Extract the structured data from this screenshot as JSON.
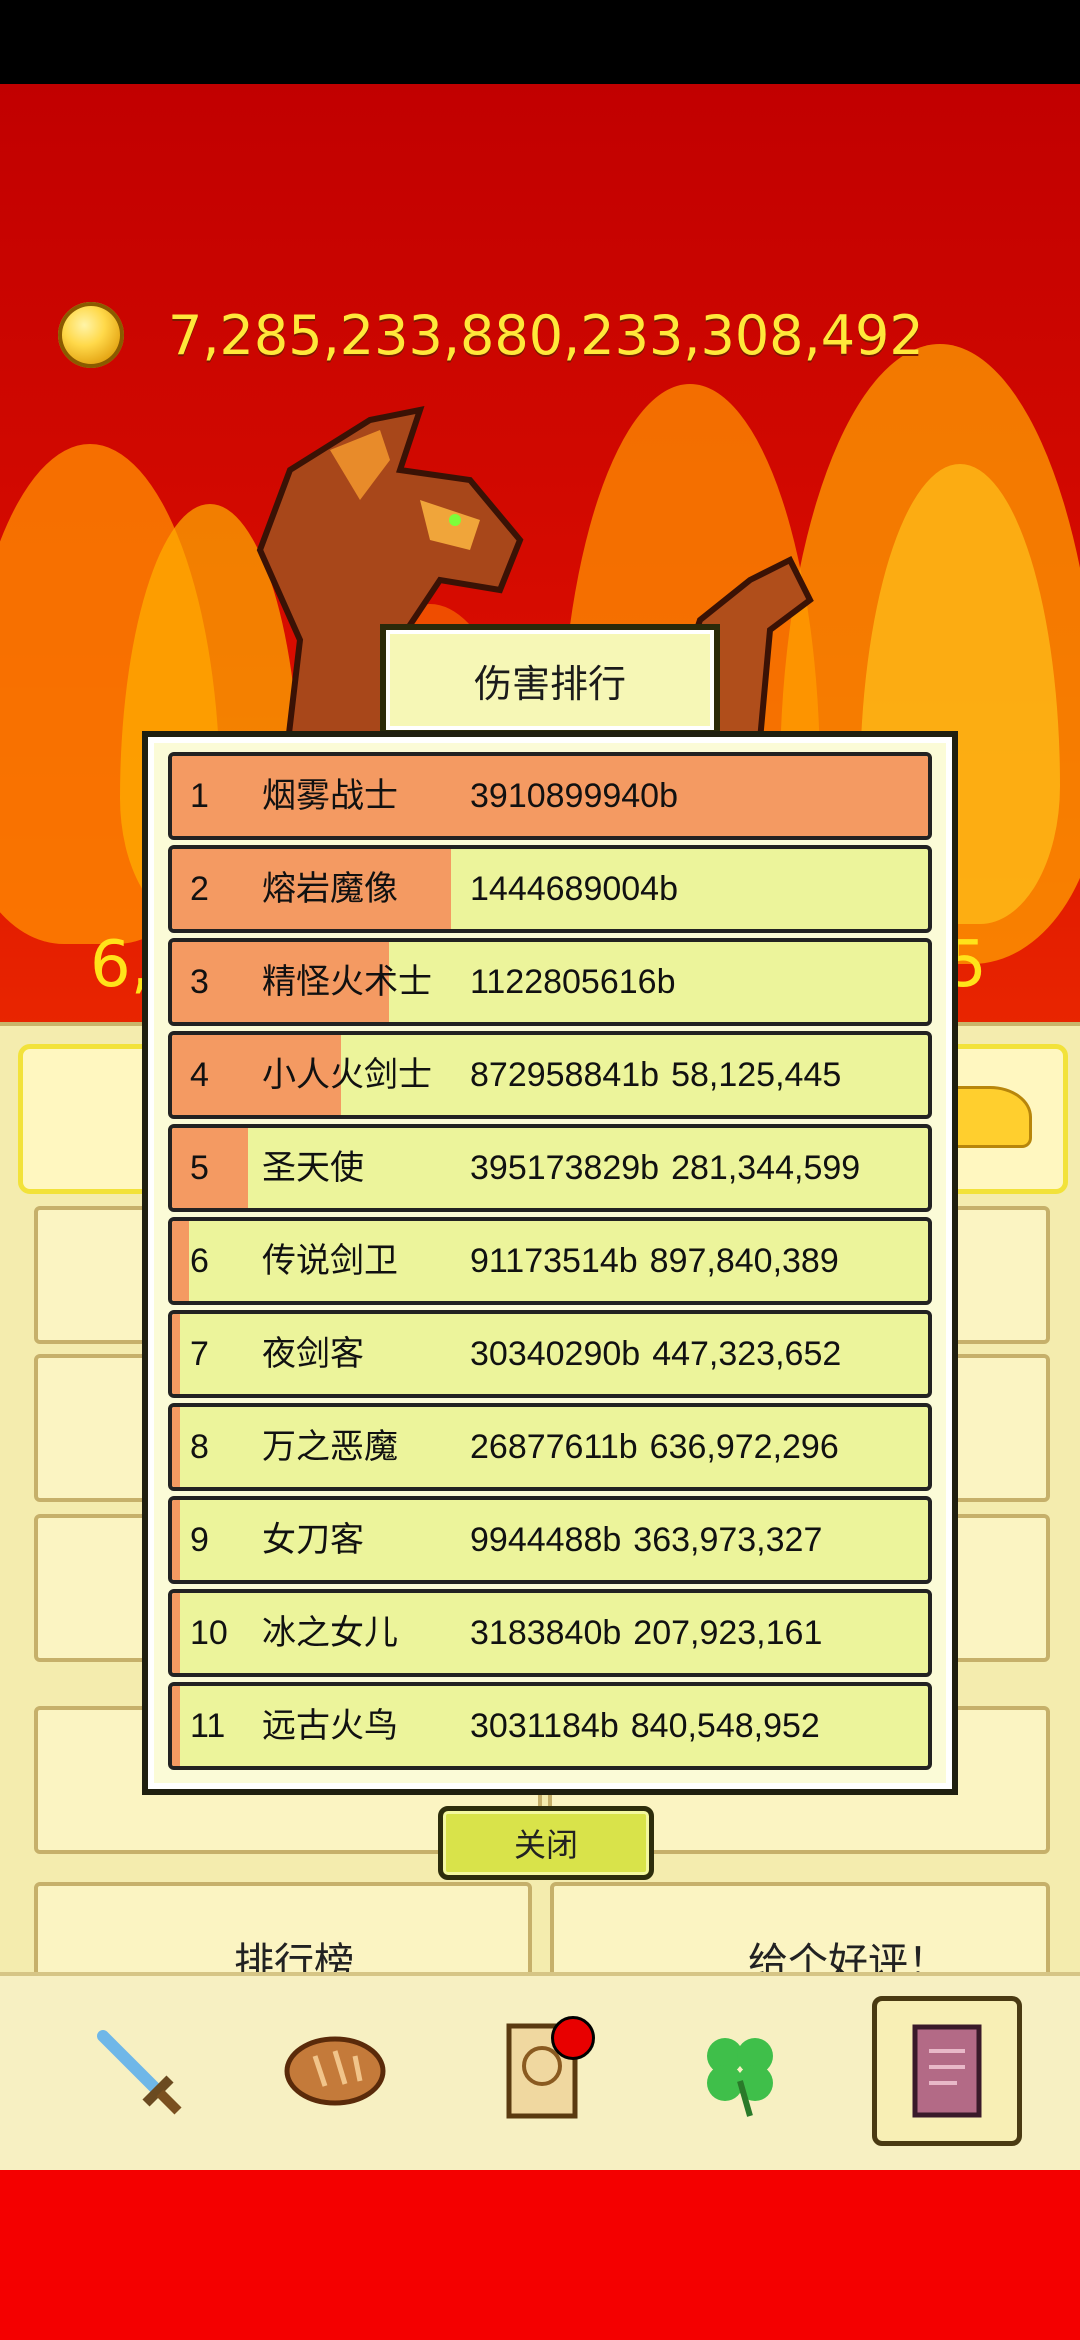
{
  "gold": {
    "icon": "gold-coin-icon",
    "amount": "7,285,233,880,233,308,492"
  },
  "side_values": {
    "left": "6,",
    "right": "5"
  },
  "dialog": {
    "title": "伤害排行",
    "close_label": "关闭",
    "rows": [
      {
        "rank": "1",
        "name": "烟雾战士",
        "damage": "3910899940b",
        "extra": "",
        "share": 1.0
      },
      {
        "rank": "2",
        "name": "熔岩魔像",
        "damage": "1444689004b",
        "extra": "",
        "share": 0.369
      },
      {
        "rank": "3",
        "name": "精怪火术士",
        "damage": "1122805616b",
        "extra": "",
        "share": 0.287
      },
      {
        "rank": "4",
        "name": "小人火剑士",
        "damage": "872958841b",
        "extra": "58,125,445",
        "share": 0.223
      },
      {
        "rank": "5",
        "name": "圣天使",
        "damage": "395173829b",
        "extra": "281,344,599",
        "share": 0.101
      },
      {
        "rank": "6",
        "name": "传说剑卫",
        "damage": "91173514b",
        "extra": "897,840,389",
        "share": 0.023
      },
      {
        "rank": "7",
        "name": "夜剑客",
        "damage": "30340290b",
        "extra": "447,323,652",
        "share": 0.008
      },
      {
        "rank": "8",
        "name": "万之恶魔",
        "damage": "26877611b",
        "extra": "636,972,296",
        "share": 0.007
      },
      {
        "rank": "9",
        "name": "女刀客",
        "damage": "9944488b",
        "extra": "363,973,327",
        "share": 0.0025
      },
      {
        "rank": "10",
        "name": "冰之女儿",
        "damage": "3183840b",
        "extra": "207,923,161",
        "share": 0.0008
      },
      {
        "rank": "11",
        "name": "远古火鸟",
        "damage": "3031184b",
        "extra": "840,548,952",
        "share": 0.0008
      }
    ]
  },
  "background_menu": {
    "items": [
      "排行榜",
      "给个好评！"
    ]
  },
  "bottom_nav": [
    {
      "icon": "sword-icon",
      "active": false
    },
    {
      "icon": "bread-icon",
      "active": false
    },
    {
      "icon": "scroll-icon",
      "active": false,
      "badge": true
    },
    {
      "icon": "clover-icon",
      "active": false
    },
    {
      "icon": "book-icon",
      "active": true
    }
  ],
  "colors": {
    "background_red": "#d80c00",
    "gold_text": "#ffe83a",
    "row_bg": "#ecf49b",
    "row_fill": "#f49a62",
    "panel": "#f4ecae"
  }
}
